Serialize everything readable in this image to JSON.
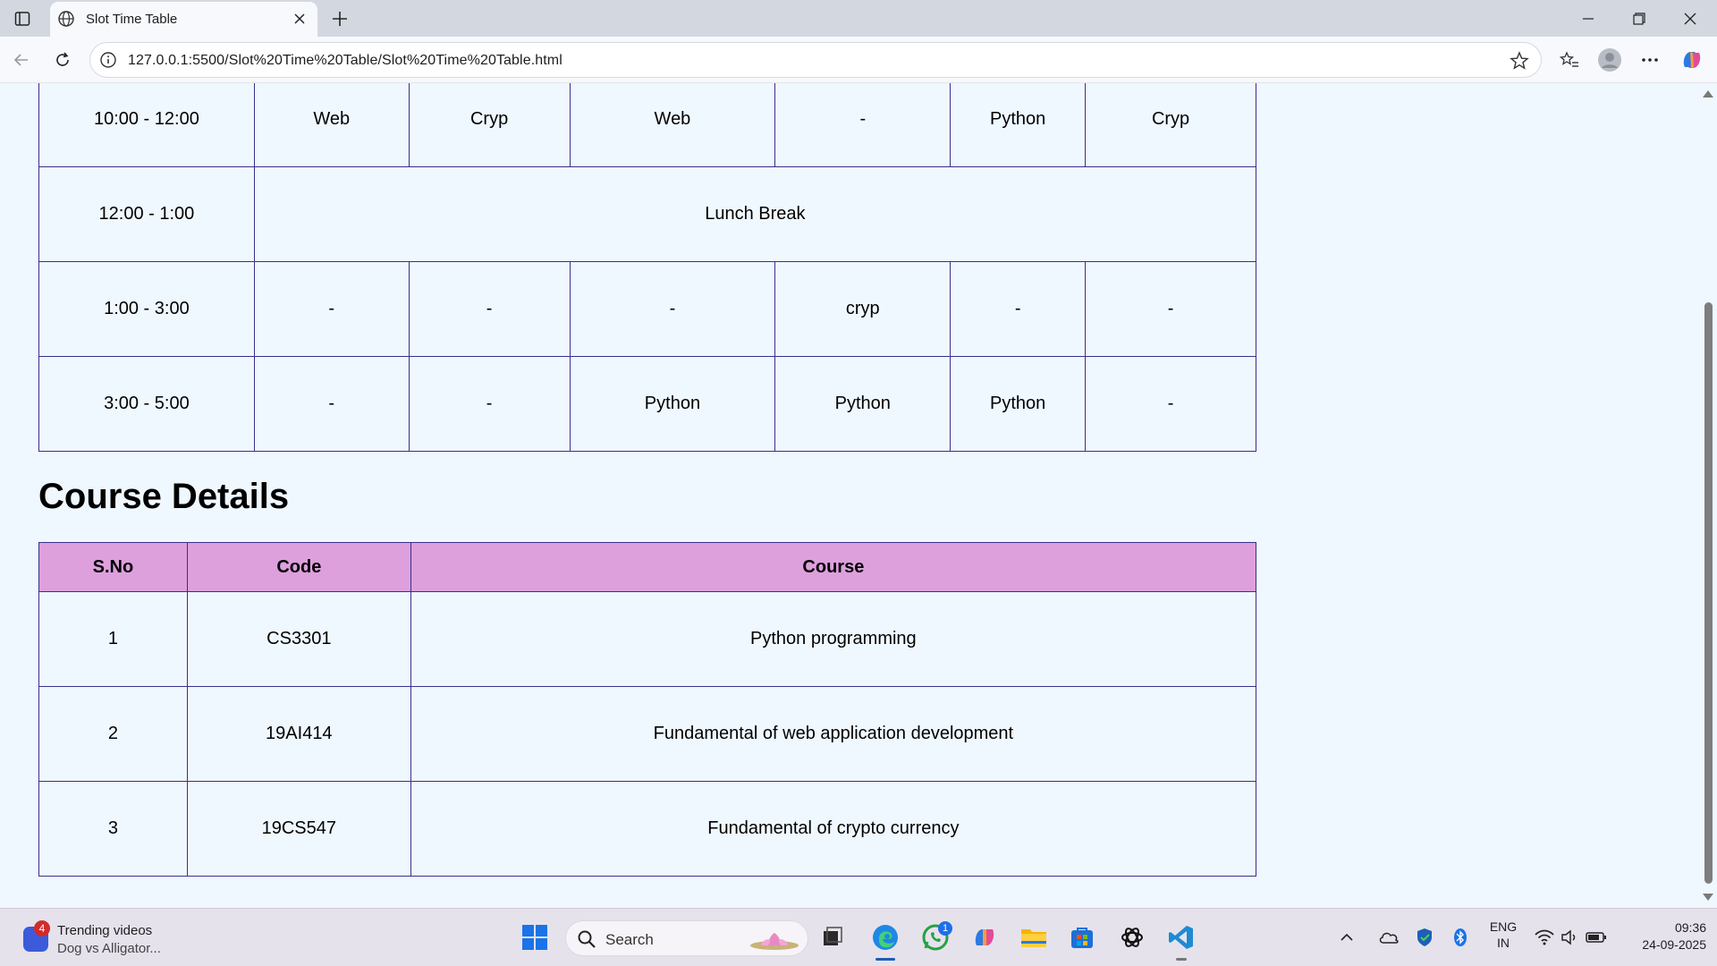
{
  "browser": {
    "tab_title": "Slot Time Table",
    "url": "127.0.0.1:5500/Slot%20Time%20Table/Slot%20Time%20Table.html"
  },
  "timetable": {
    "rows": [
      {
        "time": "10:00 - 12:00",
        "cells": [
          "Web",
          "Cryp",
          "Web",
          "-",
          "Python",
          "Cryp"
        ]
      },
      {
        "time": "12:00 - 1:00",
        "lunch": "Lunch Break"
      },
      {
        "time": "1:00 - 3:00",
        "cells": [
          "-",
          "-",
          "-",
          "cryp",
          "-",
          "-"
        ]
      },
      {
        "time": "3:00 - 5:00",
        "cells": [
          "-",
          "-",
          "Python",
          "Python",
          "Python",
          "-"
        ]
      }
    ]
  },
  "course_details": {
    "heading": "Course Details",
    "headers": [
      "S.No",
      "Code",
      "Course"
    ],
    "rows": [
      [
        "1",
        "CS3301",
        "Python programming"
      ],
      [
        "2",
        "19AI414",
        "Fundamental of web application development"
      ],
      [
        "3",
        "19CS547",
        "Fundamental of crypto currency"
      ]
    ]
  },
  "taskbar": {
    "widget_badge": "4",
    "widget_title": "Trending videos",
    "widget_subtitle": "Dog vs Alligator...",
    "search_label": "Search",
    "whatsapp_badge": "1",
    "language": "ENG",
    "region": "IN",
    "time": "09:36",
    "date": "24-09-2025"
  },
  "colors": {
    "page_bg": "#f0f8ff",
    "table_border": "#3a2e8c",
    "course_header_bg": "#dda0dd"
  }
}
